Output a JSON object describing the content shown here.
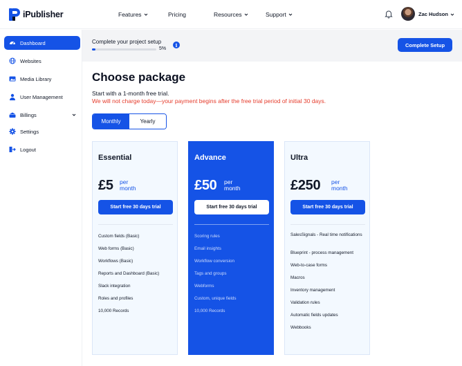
{
  "brand": {
    "name": "iPublisher"
  },
  "nav": {
    "items": [
      {
        "label": "Features",
        "has_dropdown": true
      },
      {
        "label": "Pricing",
        "has_dropdown": false
      },
      {
        "label": "Resources",
        "has_dropdown": true
      },
      {
        "label": "Support",
        "has_dropdown": true
      }
    ]
  },
  "user": {
    "name": "Zac Hudson"
  },
  "sidebar": {
    "items": [
      {
        "label": "Dashboard",
        "icon": "dashboard-icon",
        "active": true
      },
      {
        "label": "Websites",
        "icon": "globe-icon"
      },
      {
        "label": "Media Library",
        "icon": "image-icon"
      },
      {
        "label": "User Management",
        "icon": "user-icon"
      },
      {
        "label": "Billings",
        "icon": "wallet-icon",
        "has_dropdown": true
      },
      {
        "label": "Settings",
        "icon": "gear-icon"
      },
      {
        "label": "Logout",
        "icon": "logout-icon"
      }
    ]
  },
  "setup": {
    "title": "Complete your project setup",
    "progress_percent": 5,
    "progress_label": "5%",
    "button_label": "Complete Setup"
  },
  "main": {
    "title": "Choose package",
    "subtitle": "Start with a 1-month free trial.",
    "notice": "We will not charge today—your payment begins after the free trial period of initial 30 days.",
    "billing_toggle": {
      "monthly": "Monthly",
      "yearly": "Yearly",
      "selected": "Monthly"
    }
  },
  "plans": [
    {
      "name": "Essential",
      "price": "£5",
      "per_1": "per",
      "per_2": "month",
      "button": "Start free 30 days trial",
      "features": [
        "Custom fields (Basic)",
        "Web forms (Basic)",
        "Workflows (Basic)",
        "Reports and Dashboard (Basic)",
        "Slack integration",
        "Roles and profiles",
        "10,000 Records"
      ]
    },
    {
      "name": "Advance",
      "price": "£50",
      "per_1": "per",
      "per_2": "month",
      "button": "Start free 30 days trial",
      "featured": true,
      "features": [
        "Scoring rules",
        "Email insights",
        "Workflow conversion",
        "Tags and groups",
        "Webforms",
        "Custom, unique fields",
        "10,000 Records"
      ]
    },
    {
      "name": "Ultra",
      "price": "£250",
      "per_1": "per",
      "per_2": "month",
      "button": "Start free 30 days trial",
      "features": [
        "SalesSignals - Real time notifications",
        "Blueprint -  process management",
        "Web-to-case forms",
        "Macros",
        "Inventory management",
        "Validation rules",
        "Automatic fields updates",
        "Webbooks"
      ]
    }
  ],
  "colors": {
    "accent": "#1553e6",
    "notice": "#e53b2b",
    "card_bg": "#f3f9ff",
    "banner_bg": "#f3f4f6"
  }
}
